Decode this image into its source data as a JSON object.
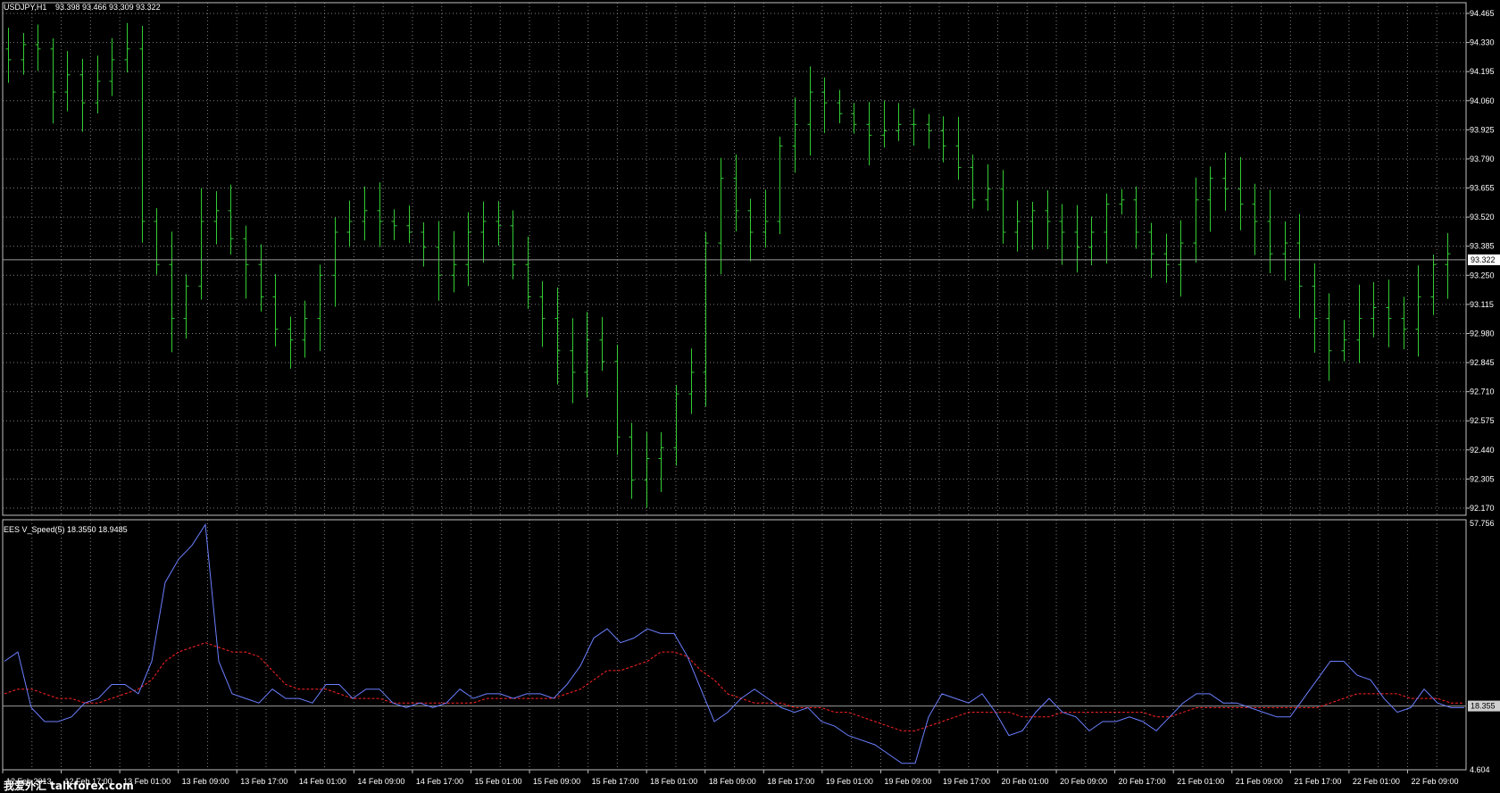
{
  "main_header": {
    "symbol": "USDJPY,H1",
    "ohlc": "93.398 93.466 93.309 93.322"
  },
  "sub_header": {
    "indicator": "EES V_Speed(5) 18.3550 18.9485"
  },
  "watermark": "我爱外汇 talkforex.com",
  "colors": {
    "background": "#000000",
    "grid": "#7f7f7f",
    "bars": "#33cc33",
    "speed_line": "#6b7fff",
    "signal_line": "#ff2222",
    "price_line": "#9a9a9a"
  },
  "chart_data": [
    {
      "type": "ohlc",
      "title": "USDJPY,H1",
      "ylim": [
        92.17,
        94.465
      ],
      "y_ticks": [
        "94.465",
        "94.330",
        "94.195",
        "94.060",
        "93.925",
        "93.790",
        "93.655",
        "93.520",
        "93.385",
        "93.250",
        "93.115",
        "92.980",
        "92.845",
        "92.710",
        "92.575",
        "92.440",
        "92.305",
        "92.170"
      ],
      "current_price": "93.322",
      "current_value": 93.322,
      "x_ticks": [
        "12 Feb 2013",
        "12 Feb 17:00",
        "13 Feb 01:00",
        "13 Feb 09:00",
        "13 Feb 17:00",
        "14 Feb 01:00",
        "14 Feb 09:00",
        "14 Feb 17:00",
        "15 Feb 01:00",
        "15 Feb 09:00",
        "15 Feb 17:00",
        "18 Feb 01:00",
        "18 Feb 09:00",
        "18 Feb 17:00",
        "19 Feb 01:00",
        "19 Feb 09:00",
        "19 Feb 17:00",
        "20 Feb 01:00",
        "20 Feb 09:00",
        "20 Feb 17:00",
        "21 Feb 01:00",
        "21 Feb 09:00",
        "21 Feb 17:00",
        "22 Feb 01:00",
        "22 Feb 09:00"
      ],
      "close_path": [
        94.25,
        94.32,
        94.3,
        94.1,
        94.18,
        94.05,
        94.15,
        94.25,
        94.3,
        93.5,
        93.3,
        93.05,
        93.2,
        93.5,
        93.55,
        93.42,
        93.3,
        93.15,
        93.0,
        92.95,
        93.05,
        93.25,
        93.45,
        93.5,
        93.55,
        93.5,
        93.48,
        93.45,
        93.38,
        93.25,
        93.3,
        93.45,
        93.5,
        93.48,
        93.3,
        93.15,
        93.05,
        92.9,
        92.8,
        92.95,
        92.85,
        92.5,
        92.3,
        92.4,
        92.45,
        92.7,
        92.8,
        93.4,
        93.7,
        93.55,
        93.45,
        93.5,
        93.85,
        93.95,
        94.1,
        94.05,
        94.0,
        93.95,
        93.9,
        93.92,
        93.95,
        93.95,
        93.92,
        93.85,
        93.75,
        93.6,
        93.65,
        93.45,
        93.5,
        93.55,
        93.5,
        93.45,
        93.38,
        93.45,
        93.58,
        93.6,
        93.45,
        93.35,
        93.3,
        93.4,
        93.6,
        93.7,
        93.65,
        93.58,
        93.5,
        93.35,
        93.4,
        93.2,
        93.05,
        92.9,
        92.95,
        93.05,
        93.1,
        93.05,
        93.0,
        93.15,
        93.3,
        93.35
      ]
    },
    {
      "type": "line",
      "title": "EES V_Speed(5) 18.3550 18.9485",
      "ylim": [
        4.604,
        57.756
      ],
      "y_ticks": [
        "57.756",
        "4.604"
      ],
      "current_label": "18.355",
      "current_value": 18.355,
      "series": [
        {
          "values": [
            28,
            30,
            18,
            15,
            15,
            16,
            19,
            20,
            23,
            23,
            21,
            28,
            45,
            50,
            53,
            57.5,
            28,
            21,
            20,
            19,
            22,
            20,
            20,
            19,
            23,
            23,
            20,
            22,
            22,
            19,
            18,
            19,
            18,
            19,
            22,
            20,
            21,
            21,
            20,
            21,
            21,
            20,
            23,
            27,
            33,
            35,
            32,
            33,
            35,
            34,
            34,
            29,
            22,
            15,
            17,
            20,
            22,
            20,
            18,
            17,
            18,
            15,
            14,
            12,
            11,
            10,
            8,
            6,
            6,
            16,
            21,
            20,
            19,
            21,
            17,
            12,
            13,
            17,
            20,
            17,
            16,
            13,
            15,
            15,
            16,
            15,
            13,
            16,
            19,
            21,
            21,
            19,
            19,
            18,
            17,
            16,
            16,
            20,
            24,
            28,
            28,
            25,
            24,
            20,
            17,
            18,
            22,
            19,
            18,
            18
          ]
        },
        {
          "values": [
            21,
            22,
            22,
            21,
            20,
            20,
            19,
            19,
            20,
            21,
            22,
            24,
            28,
            30,
            31,
            32,
            31,
            30,
            30,
            29,
            26,
            23,
            22,
            22,
            22,
            21,
            20,
            20,
            20,
            19,
            19,
            19,
            19,
            19,
            19,
            19,
            20,
            20,
            20,
            20,
            20,
            20,
            21,
            22,
            24,
            26,
            26,
            27,
            28,
            30,
            30,
            29,
            26,
            24,
            21,
            20,
            19,
            19,
            19,
            18,
            18,
            18,
            17,
            17,
            16,
            15,
            14,
            13,
            13,
            14,
            15,
            16,
            17,
            17,
            17,
            17,
            16,
            16,
            16,
            17,
            17,
            17,
            17,
            17,
            17,
            17,
            16,
            16,
            17,
            18,
            18,
            18,
            18,
            18,
            18,
            18,
            18,
            18,
            18,
            19,
            20,
            21,
            21,
            21,
            21,
            20,
            20,
            20,
            19,
            19
          ]
        }
      ]
    }
  ]
}
